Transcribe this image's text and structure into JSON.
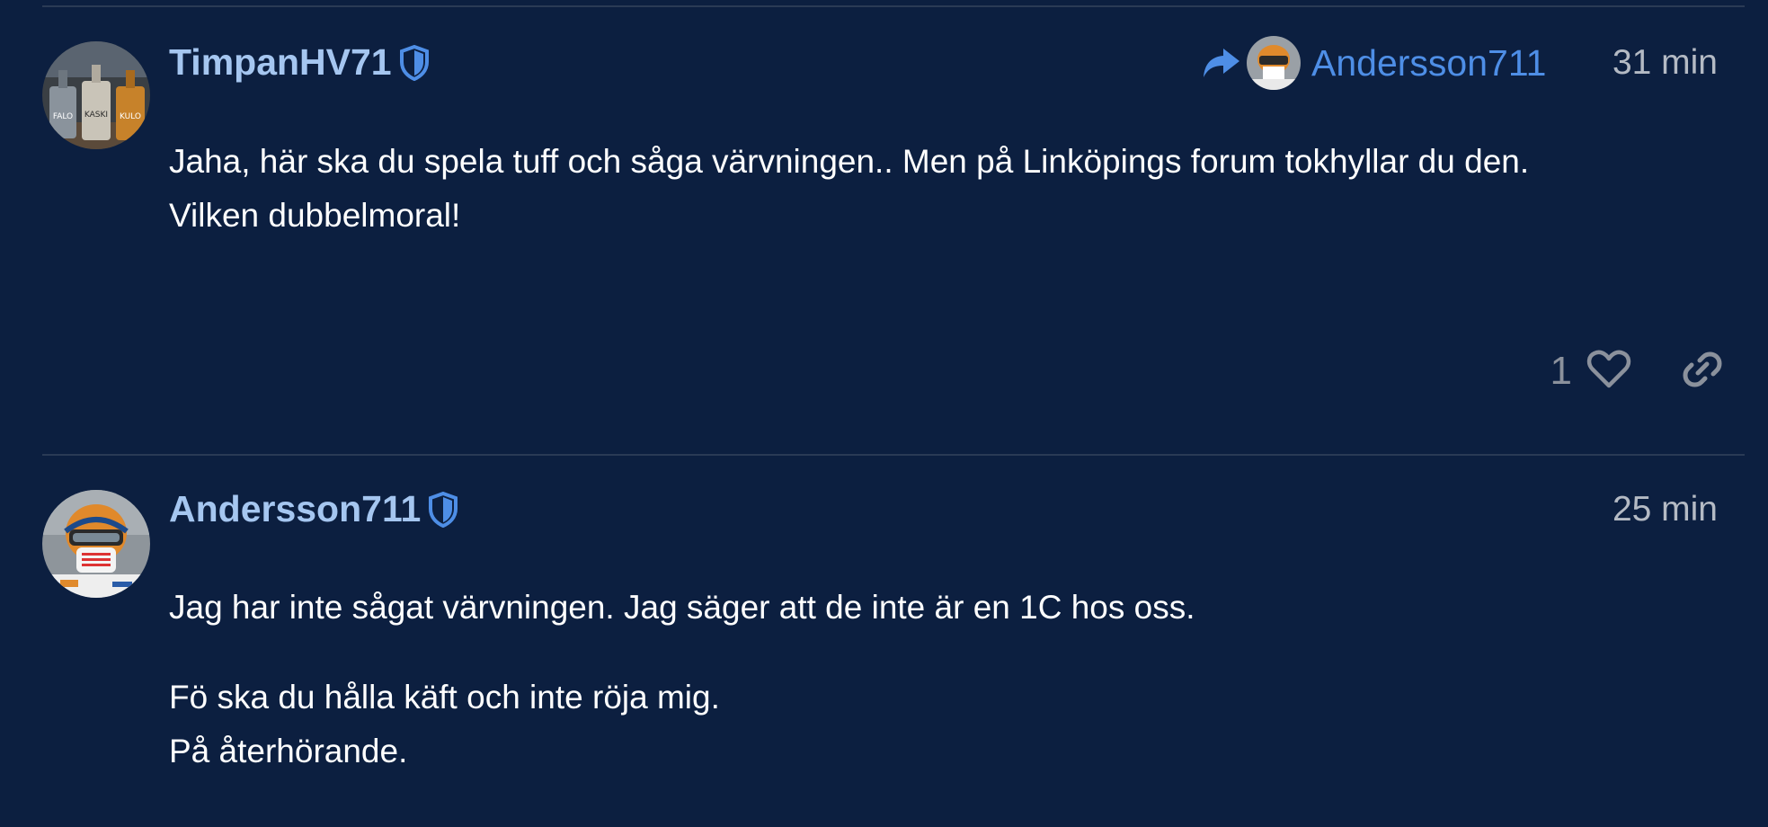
{
  "posts": [
    {
      "username": "TimpanHV71",
      "time": "31 min",
      "reply_to": {
        "username": "Andersson711"
      },
      "paragraphs": [
        "Jaha, här ska du spela tuff och såga värvningen.. Men på Linköpings forum tokhyllar du den.\nVilken dubbelmoral!"
      ],
      "like_count": "1",
      "avatar_icon": "avatar-bottles",
      "avatar_labels": [
        "FALO",
        "KASKI",
        "KULO"
      ]
    },
    {
      "username": "Andersson711",
      "time": "25 min",
      "paragraphs": [
        "Jag har inte sågat värvningen. Jag säger att de inte är en 1C hos oss.",
        "Fö ska du hålla käft och inte röja mig.\nPå återhörande."
      ],
      "avatar_icon": "avatar-helmet-rider"
    }
  ],
  "colors": {
    "background": "#0c1f40",
    "username": "#a5c6f0",
    "link_blue": "#4e8ee6",
    "muted": "#b4bac4",
    "divider": "#2a3a55"
  },
  "icons": [
    "shield-icon",
    "reply-arrow-icon",
    "heart-icon",
    "link-icon"
  ]
}
